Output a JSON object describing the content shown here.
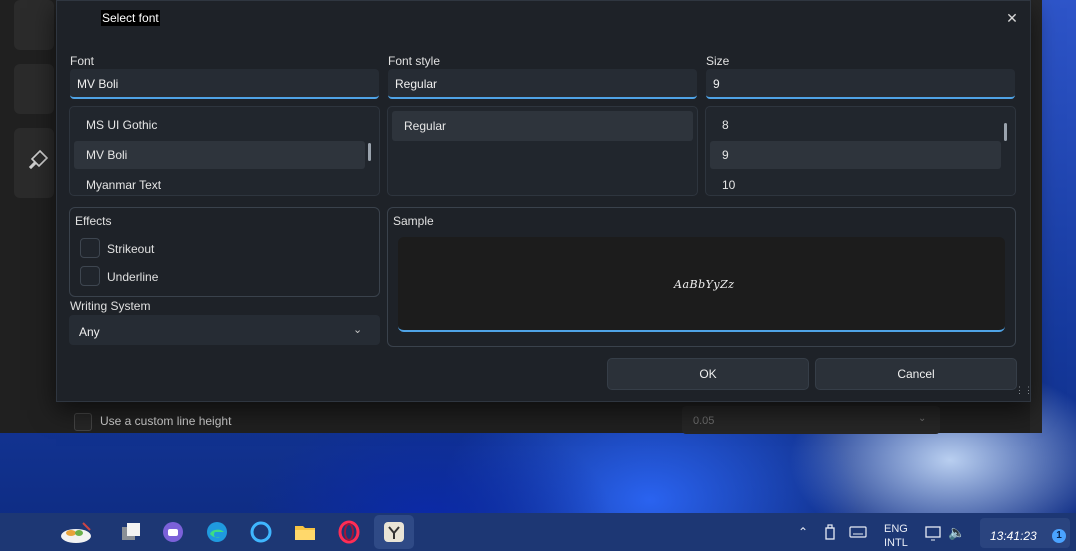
{
  "background_app": {
    "custom_line_height_label": "Use a custom line height",
    "line_height_value": "0.05"
  },
  "dialog": {
    "title": "Select font",
    "font": {
      "label": "Font",
      "value": "MV Boli",
      "list": [
        "MS UI Gothic",
        "MV Boli",
        "Myanmar Text"
      ],
      "selected_index": 1
    },
    "font_style": {
      "label": "Font style",
      "value": "Regular",
      "list": [
        "Regular"
      ],
      "selected_index": 0
    },
    "size": {
      "label": "Size",
      "value": "9",
      "list": [
        "8",
        "9",
        "10"
      ],
      "selected_index": 1
    },
    "effects": {
      "label": "Effects",
      "strikeout": {
        "label": "Strikeout",
        "checked": false
      },
      "underline": {
        "label": "Underline",
        "checked": false
      }
    },
    "writing_system": {
      "label": "Writing System",
      "value": "Any"
    },
    "sample": {
      "label": "Sample",
      "text": "AaBbYyZz"
    },
    "ok_label": "OK",
    "cancel_label": "Cancel"
  },
  "taskbar": {
    "apps": [
      "widgets-icon",
      "task-view-icon",
      "chat-icon",
      "edge-icon",
      "cortana-icon",
      "file-explorer-icon",
      "opera-icon",
      "app-icon"
    ],
    "tray": {
      "language_line1": "ENG",
      "language_line2": "INTL",
      "clock": "13:41:23",
      "notification_count": "1"
    }
  },
  "colors": {
    "accent": "#4fa3e6",
    "dialog_bg": "#1e2228",
    "taskbar_bg": "#1d3774"
  }
}
